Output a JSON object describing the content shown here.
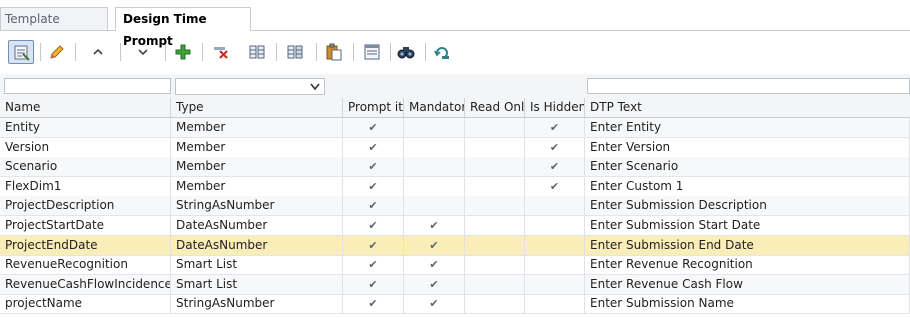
{
  "tabs": [
    {
      "label": "Template Designer",
      "active": false
    },
    {
      "label": "Design Time Prompt",
      "active": true
    }
  ],
  "toolbar": {
    "buttons": [
      "properties-icon",
      "edit-pencil-icon",
      "move-up-icon",
      "move-down-icon",
      "add-icon",
      "delete-icon",
      "insert-column-icon",
      "insert-row-icon",
      "paste-icon",
      "template-icon",
      "find-icon",
      "refresh-icon"
    ]
  },
  "filters": {
    "name": "",
    "type_selected": ""
  },
  "columns": [
    "Name",
    "Type",
    "Prompt it?",
    "Mandatory",
    "Read Only",
    "Is Hidden",
    "DTP Text"
  ],
  "check_glyph": "✔",
  "rows": [
    {
      "name": "Entity",
      "type": "Member",
      "prompt": true,
      "mandatory": false,
      "readonly": false,
      "hidden": true,
      "dtp": "Enter Entity"
    },
    {
      "name": "Version",
      "type": "Member",
      "prompt": true,
      "mandatory": false,
      "readonly": false,
      "hidden": true,
      "dtp": "Enter Version"
    },
    {
      "name": "Scenario",
      "type": "Member",
      "prompt": true,
      "mandatory": false,
      "readonly": false,
      "hidden": true,
      "dtp": "Enter Scenario"
    },
    {
      "name": "FlexDim1",
      "type": "Member",
      "prompt": true,
      "mandatory": false,
      "readonly": false,
      "hidden": true,
      "dtp": "Enter Custom 1"
    },
    {
      "name": "ProjectDescription",
      "type": "StringAsNumber",
      "prompt": true,
      "mandatory": false,
      "readonly": false,
      "hidden": false,
      "dtp": "Enter Submission Description"
    },
    {
      "name": "ProjectStartDate",
      "type": "DateAsNumber",
      "prompt": true,
      "mandatory": true,
      "readonly": false,
      "hidden": false,
      "dtp": "Enter Submission Start Date"
    },
    {
      "name": "ProjectEndDate",
      "type": "DateAsNumber",
      "prompt": true,
      "mandatory": true,
      "readonly": false,
      "hidden": false,
      "dtp": "Enter Submission End Date",
      "selected": true
    },
    {
      "name": "RevenueRecognition",
      "type": "Smart List",
      "prompt": true,
      "mandatory": true,
      "readonly": false,
      "hidden": false,
      "dtp": "Enter Revenue Recognition"
    },
    {
      "name": "RevenueCashFlowIncidence",
      "type": "Smart List",
      "prompt": true,
      "mandatory": true,
      "readonly": false,
      "hidden": false,
      "dtp": "Enter Revenue Cash Flow"
    },
    {
      "name": "projectName",
      "type": "StringAsNumber",
      "prompt": true,
      "mandatory": true,
      "readonly": false,
      "hidden": false,
      "dtp": "Enter Submission Name"
    }
  ]
}
